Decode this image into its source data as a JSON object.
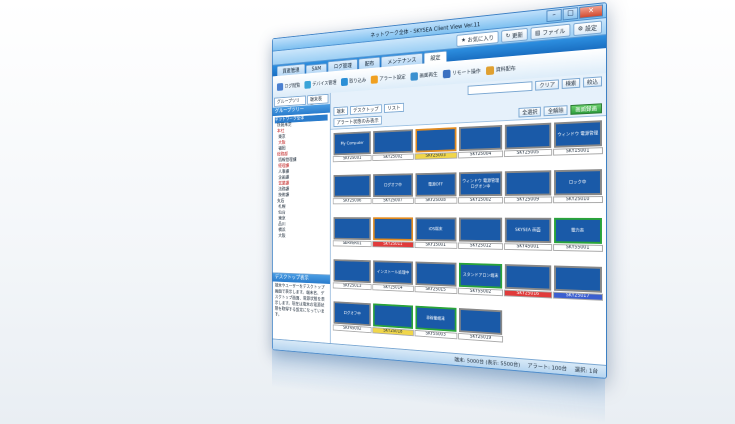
{
  "window": {
    "title": "ネットワーク全体 - SKYSEA Client View Ver.11"
  },
  "topbar": {
    "fav": "お気に入り",
    "update": "更新",
    "file": "ファイル",
    "settings": "設定"
  },
  "tabs": [
    "資産管理",
    "SAM",
    "ログ管理",
    "配布",
    "メンテナンス",
    "設定"
  ],
  "ribbon": [
    {
      "label": "ログ閲覧",
      "color": "#4a7fd0"
    },
    {
      "label": "デバイス管理",
      "color": "#3aa4d8"
    },
    {
      "label": "取り込み",
      "color": "#2b8fd6"
    },
    {
      "label": "アラート設定",
      "color": "#f0a020"
    },
    {
      "label": "画面再生",
      "color": "#3a90d0"
    },
    {
      "label": "リモート操作",
      "color": "#3a70c0"
    },
    {
      "label": "資料配布",
      "color": "#e0a030"
    }
  ],
  "left": {
    "group_btn": "グループツリー",
    "sort_btn": "端末表示",
    "title": "グループツリー",
    "tree": [
      {
        "t": "ネットワーク全体",
        "cls": "sel"
      },
      {
        "t": "  所属未定",
        "cls": ""
      },
      {
        "t": "  本社",
        "cls": "red"
      },
      {
        "t": "   東京",
        "cls": ""
      },
      {
        "t": "   大阪",
        "cls": "red"
      },
      {
        "t": "   福岡",
        "cls": ""
      },
      {
        "t": "  総務部",
        "cls": "red"
      },
      {
        "t": "   情報管理課",
        "cls": ""
      },
      {
        "t": "   経理課",
        "cls": "red"
      },
      {
        "t": "   人事課",
        "cls": ""
      },
      {
        "t": "   企画課",
        "cls": ""
      },
      {
        "t": "   営業課",
        "cls": "red"
      },
      {
        "t": "   法務課",
        "cls": ""
      },
      {
        "t": "   技術課",
        "cls": ""
      },
      {
        "t": "  支店",
        "cls": ""
      },
      {
        "t": "   札幌",
        "cls": ""
      },
      {
        "t": "   仙台",
        "cls": ""
      },
      {
        "t": "   東京",
        "cls": ""
      },
      {
        "t": "   品川",
        "cls": ""
      },
      {
        "t": "   横浜",
        "cls": ""
      },
      {
        "t": "   大阪",
        "cls": ""
      }
    ],
    "desktop_title": "デスクトップ表示",
    "desktop_text": "端末やユーザーをデスクトップ画面で表示します。端末名、デスクトップ画面、電源状態を表示します。現在は端末の電源状態を取得する設定になっています。"
  },
  "filter": {
    "clear": "クリア",
    "search": "検索",
    "narrow": "絞込"
  },
  "view": {
    "terminal": "端末",
    "desktop": "デスクトップ",
    "list": "リスト"
  },
  "selbar": {
    "alert": "アラート状態のみ表示",
    "select_all": "全選択",
    "deselect_all": "全解除",
    "record": "画面録画"
  },
  "tiles": [
    {
      "name": "SKY25001",
      "screen": "My Computer",
      "cls": "",
      "lcls": ""
    },
    {
      "name": "SKY25002",
      "screen": "",
      "cls": "",
      "lcls": ""
    },
    {
      "name": "SKY25003",
      "screen": "",
      "cls": "orange",
      "lcls": "ylw"
    },
    {
      "name": "SKY25004",
      "screen": "",
      "cls": "",
      "lcls": ""
    },
    {
      "name": "SKY25005",
      "screen": "",
      "cls": "",
      "lcls": ""
    },
    {
      "name": "SKY15001",
      "screen": "ウィンドウ 電源管理",
      "cls": "",
      "lcls": ""
    },
    {
      "name": "SKY25006",
      "screen": "",
      "cls": "",
      "lcls": ""
    },
    {
      "name": "SKY25007",
      "screen": "ログオフ中",
      "cls": "",
      "lcls": ""
    },
    {
      "name": "SKY25008",
      "screen": "電源OFF",
      "cls": "",
      "lcls": ""
    },
    {
      "name": "SKY15002",
      "screen": "ウィンドウ 電源管理 ログオン中",
      "cls": "",
      "lcls": ""
    },
    {
      "name": "SKY25009",
      "screen": "",
      "cls": "",
      "lcls": ""
    },
    {
      "name": "SKY25010",
      "screen": "ロック中",
      "cls": "",
      "lcls": ""
    },
    {
      "name": "SERVER01",
      "screen": "",
      "cls": "",
      "lcls": ""
    },
    {
      "name": "SKY25011",
      "screen": "",
      "cls": "orange",
      "lcls": "red"
    },
    {
      "name": "SKY15001",
      "screen": "iOS端末",
      "cls": "",
      "lcls": ""
    },
    {
      "name": "SKY25012",
      "screen": "",
      "cls": "",
      "lcls": ""
    },
    {
      "name": "SKY45001",
      "screen": "SKYSEA 画面",
      "cls": "",
      "lcls": ""
    },
    {
      "name": "SKY55001",
      "screen": "電力表",
      "cls": "green",
      "lcls": ""
    },
    {
      "name": "SKY25013",
      "screen": "",
      "cls": "",
      "lcls": ""
    },
    {
      "name": "SKY25014",
      "screen": "インストール処理中",
      "cls": "",
      "lcls": ""
    },
    {
      "name": "SKY25015",
      "screen": "",
      "cls": "",
      "lcls": ""
    },
    {
      "name": "SKY55002",
      "screen": "スタンドアロン端末",
      "cls": "green",
      "lcls": ""
    },
    {
      "name": "SKY25016",
      "screen": "",
      "cls": "",
      "lcls": "red"
    },
    {
      "name": "SKY25017",
      "screen": "",
      "cls": "",
      "lcls": "blue"
    },
    {
      "name": "SKY45002",
      "screen": "ログオフ中",
      "cls": "",
      "lcls": ""
    },
    {
      "name": "SKY25018",
      "screen": "",
      "cls": "green",
      "lcls": "ylw"
    },
    {
      "name": "SKY55003",
      "screen": "非稼働端末",
      "cls": "green",
      "lcls": ""
    },
    {
      "name": "SKY25019",
      "screen": "",
      "cls": "",
      "lcls": ""
    }
  ],
  "status": {
    "count": "端末: 5000台 (表示: 5500台)",
    "alert": "アラート: 100台",
    "selected": "選択: 1台"
  }
}
